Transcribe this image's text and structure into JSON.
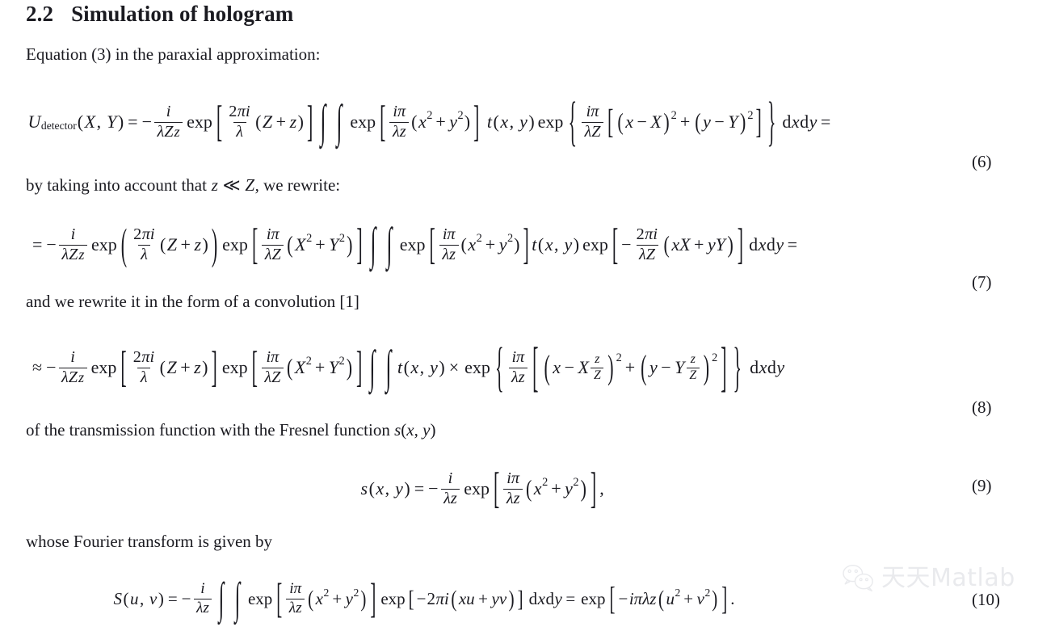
{
  "document": {
    "section_number": "2.2",
    "section_title": "Simulation of hologram",
    "paragraphs": {
      "intro": "Equation (3) in the paraxial approximation:",
      "after_eq6": "by taking into account that z ≪ Z, we rewrite:",
      "after_eq7": "and we rewrite it in the form of a convolution [1]",
      "after_eq8": "of the transmission function with the Fresnel function s(x, y)",
      "after_eq9": "whose Fourier transform is given by"
    },
    "equation_numbers": {
      "eq6": "(6)",
      "eq7": "(7)",
      "eq8": "(8)",
      "eq9": "(9)",
      "eq10": "(10)"
    },
    "equations": {
      "eq6": {
        "latex": "U_{detector}(X,Y) = -\\frac{i}{\\lambda Z z}\\exp\\left[\\frac{2\\pi i}{\\lambda}(Z+z)\\right]\\int\\int \\exp\\left[\\frac{i\\pi}{\\lambda z}(x^2+y^2)\\right] t(x,y)\\exp\\left\\{\\frac{i\\pi}{\\lambda Z}\\left[(x-X)^2+(y-Y)^2\\right]\\right\\}\\mathrm{d}x\\mathrm{d}y =",
        "lhs_function": "U",
        "lhs_subscript": "detector",
        "lhs_args": "(X, Y)"
      },
      "eq7": {
        "latex": "= -\\frac{i}{\\lambda Z z}\\exp\\left(\\frac{2\\pi i}{\\lambda}(Z+z)\\right)\\exp\\left[\\frac{i\\pi}{\\lambda Z}\\left(X^2+Y^2\\right)\\right]\\int\\int \\exp\\left[\\frac{i\\pi}{\\lambda z}(x^2+y^2)\\right] t(x,y)\\exp\\left[-\\frac{2\\pi i}{\\lambda Z}\\left(xX+yY\\right)\\right]\\mathrm{d}x\\mathrm{d}y ="
      },
      "eq8": {
        "latex": "\\approx -\\frac{i}{\\lambda Z z}\\exp\\left[\\frac{2\\pi i}{\\lambda}(Z+z)\\right]\\exp\\left[\\frac{i\\pi}{\\lambda Z}\\left(X^2+Y^2\\right)\\right]\\int\\int t(x,y)\\times\\exp\\left\\{\\frac{i\\pi}{\\lambda z}\\left[\\left(x-X\\frac{z}{Z}\\right)^2+\\left(y-Y\\frac{z}{Z}\\right)^2\\right]\\right\\}\\mathrm{d}x\\mathrm{d}y"
      },
      "eq9": {
        "latex": "s(x,y) = -\\frac{i}{\\lambda z}\\exp\\left[\\frac{i\\pi}{\\lambda z}\\left(x^2+y^2\\right)\\right],"
      },
      "eq10": {
        "latex": "S(u,v) = -\\frac{i}{\\lambda z}\\int\\int \\exp\\left[\\frac{i\\pi}{\\lambda z}\\left(x^2+y^2\\right)\\right]\\exp\\left[-2\\pi i\\left(xu+yv\\right)\\right]\\mathrm{d}x\\mathrm{d}y = \\exp\\left[-i\\pi\\lambda z\\left(u^2+v^2\\right)\\right]."
      }
    },
    "symbols": {
      "integral": "∫",
      "lambda": "λ",
      "pi": "π",
      "approx": "≈",
      "much_less": "≪",
      "times": "×",
      "minus": "−",
      "plus": "+",
      "equals": "=",
      "dx": "d",
      "comma": ","
    }
  },
  "watermark": {
    "text": "天天Matlab",
    "icon": "wechat-logo",
    "color": "#b9bdc6"
  },
  "theme": {
    "page_background": "#ffffff",
    "text_color": "#1a1a20"
  }
}
